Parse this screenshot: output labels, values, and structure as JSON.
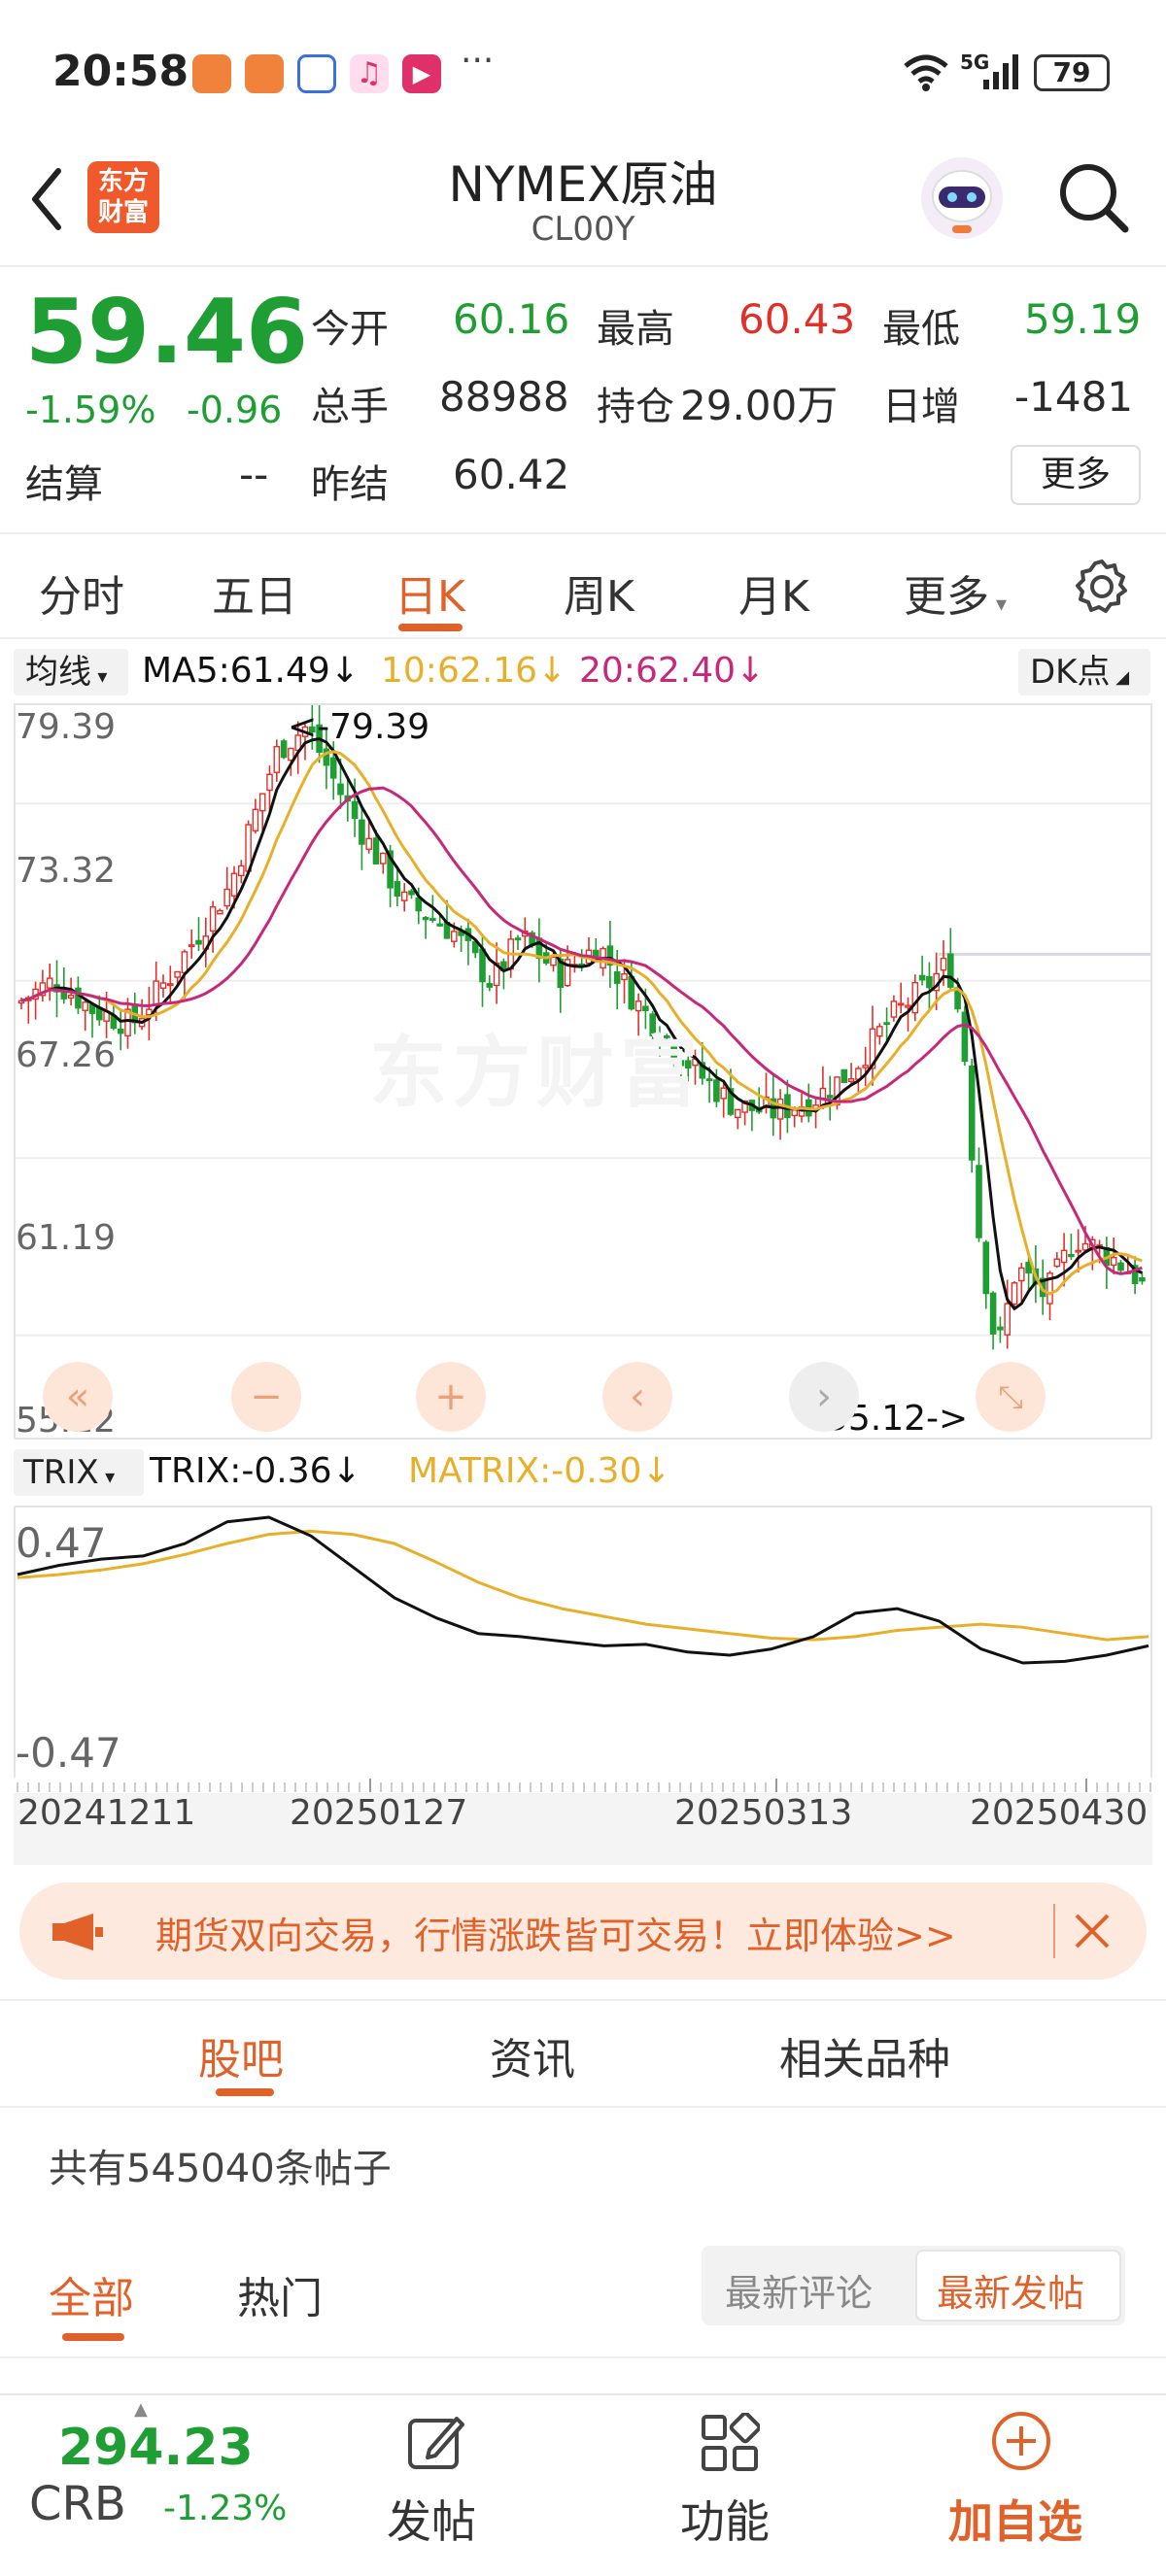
{
  "status_bar": {
    "time": "20:58",
    "dots": "···",
    "network": "5G",
    "battery": "79",
    "app_icon_colors": [
      "#f0823c",
      "#f0823c",
      "#3a6fe0",
      "#f0506a",
      "#e0306a"
    ]
  },
  "header": {
    "logo_text": "东方\n财富",
    "title": "NYMEX原油",
    "code": "CL00Y",
    "back_icon": "chevron-left-icon",
    "search_icon": "search-icon",
    "robot_icon": "robot-avatar-icon"
  },
  "quote": {
    "price": "59.46",
    "change_pct": "-1.59%",
    "change": "-0.96",
    "row1": [
      {
        "label": "今开",
        "value": "60.16",
        "color": "green"
      },
      {
        "label": "最高",
        "value": "60.43",
        "color": "red"
      },
      {
        "label": "最低",
        "value": "59.19",
        "color": "green"
      }
    ],
    "row2": [
      {
        "label": "总手",
        "value": "88988",
        "color": "dark"
      },
      {
        "label": "持仓",
        "value": "29.00万",
        "color": "dark"
      },
      {
        "label": "日增",
        "value": "-1481",
        "color": "dark"
      }
    ],
    "row3": [
      {
        "label": "结算",
        "value": "--"
      },
      {
        "label": "昨结",
        "value": "60.42"
      }
    ],
    "more_button": "更多"
  },
  "tabs": {
    "items": [
      "分时",
      "五日",
      "日K",
      "周K",
      "月K",
      "更多"
    ],
    "active_index": 2,
    "settings_icon": "gear-icon"
  },
  "ma_bar": {
    "selector": "均线",
    "ma5": "MA5:61.49",
    "ma10": "10:62.16",
    "ma20": "20:62.40",
    "dk_button": "DK点",
    "colors": {
      "ma5": "#111111",
      "ma10": "#e8b02a",
      "ma20": "#c8287a"
    }
  },
  "kchart": {
    "y_labels": [
      "79.39",
      "73.32",
      "67.26",
      "61.19",
      "55.12"
    ],
    "high_marker": "<-79.39",
    "low_marker": "55.12->",
    "watermark": "东方财富",
    "controls": [
      "double-chevron-left-icon",
      "zoom-out-icon",
      "zoom-in-icon",
      "chevron-left-icon",
      "chevron-right-icon",
      "expand-icon"
    ]
  },
  "chart_data": {
    "type": "candlestick",
    "y_range": [
      55.12,
      79.39
    ],
    "x_labels": [
      "20241211",
      "20250127",
      "20250313",
      "20250430"
    ],
    "series": [
      {
        "name": "MA5",
        "value": 61.49
      },
      {
        "name": "10",
        "value": 62.16
      },
      {
        "name": "20",
        "value": 62.4
      }
    ],
    "trix": {
      "selector": "TRIX",
      "trix_label": "TRIX:-0.36",
      "matrix_label": "MATRIX:-0.30",
      "y_labels": [
        "0.47",
        "-0.47"
      ],
      "y_range": [
        -0.47,
        0.47
      ],
      "trix_values": [
        0.1,
        0.16,
        0.2,
        0.22,
        0.3,
        0.44,
        0.47,
        0.35,
        0.15,
        -0.05,
        -0.18,
        -0.28,
        -0.3,
        -0.33,
        -0.36,
        -0.35,
        -0.4,
        -0.42,
        -0.38,
        -0.3,
        -0.15,
        -0.12,
        -0.2,
        -0.38,
        -0.47,
        -0.46,
        -0.42,
        -0.36
      ],
      "matrix_values": [
        0.08,
        0.1,
        0.13,
        0.17,
        0.23,
        0.3,
        0.36,
        0.38,
        0.36,
        0.3,
        0.18,
        0.05,
        -0.05,
        -0.12,
        -0.17,
        -0.22,
        -0.25,
        -0.28,
        -0.31,
        -0.32,
        -0.3,
        -0.26,
        -0.24,
        -0.22,
        -0.24,
        -0.28,
        -0.32,
        -0.3
      ]
    }
  },
  "banner": {
    "text": "期货双向交易，行情涨跌皆可交易！立即体验>>",
    "megaphone_icon": "megaphone-icon",
    "close_icon": "close-icon"
  },
  "community": {
    "tabs": [
      "股吧",
      "资讯",
      "相关品种"
    ],
    "active_tab": 0,
    "post_count": "共有545040条帖子",
    "filters": [
      "全部",
      "热门"
    ],
    "sort_options": [
      "最新评论",
      "最新发帖"
    ]
  },
  "bottom_nav": {
    "index_value": "294.23",
    "index_name": "CRB",
    "index_change": "-1.23%",
    "post_label": "发帖",
    "function_label": "功能",
    "add_watch_label": "加自选"
  }
}
